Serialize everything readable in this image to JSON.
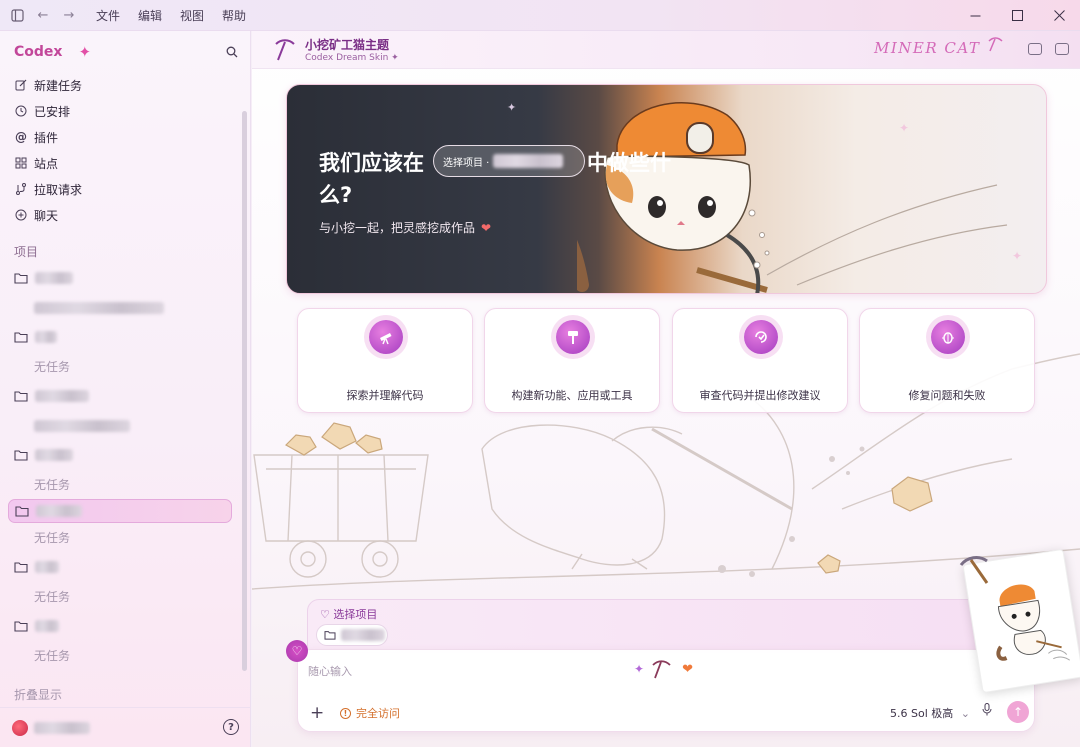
{
  "menu": {
    "file": "文件",
    "edit": "编辑",
    "view": "视图",
    "help": "帮助"
  },
  "sidebar": {
    "brand": "Codex",
    "nav": [
      {
        "label": "新建任务",
        "icon": "edit-icon"
      },
      {
        "label": "已安排",
        "icon": "clock-icon"
      },
      {
        "label": "插件",
        "icon": "at-icon"
      },
      {
        "label": "站点",
        "icon": "grid-icon"
      },
      {
        "label": "拉取请求",
        "icon": "merge-icon"
      },
      {
        "label": "聊天",
        "icon": "chat-icon"
      }
    ],
    "section_label": "项目",
    "no_task": "无任务",
    "fold_label": "折叠显示"
  },
  "header": {
    "title": "小挖矿工猫主题",
    "subtitle": "Codex Dream Skin ✦",
    "badge": "MINER CAT"
  },
  "hero": {
    "question_part1": "我们应该在",
    "project_pill": "选择项目 ·",
    "question_part2": "中做些什",
    "question_part3": "么?",
    "subtitle": "与小挖一起，把灵感挖成作品"
  },
  "cards": [
    {
      "label": "探索并理解代码",
      "icon": "telescope-icon"
    },
    {
      "label": "构建新功能、应用或工具",
      "icon": "hammer-icon"
    },
    {
      "label": "审查代码并提出修改建议",
      "icon": "review-icon"
    },
    {
      "label": "修复问题和失败",
      "icon": "bug-icon"
    }
  ],
  "composer": {
    "select_project": "♡ 选择项目",
    "placeholder": "随心输入",
    "full_access": "完全访问",
    "model": "5.6 Sol 极高"
  },
  "colors": {
    "accent": "#c2479a",
    "brand_pink": "#e24fa6",
    "warning": "#d4702c"
  }
}
